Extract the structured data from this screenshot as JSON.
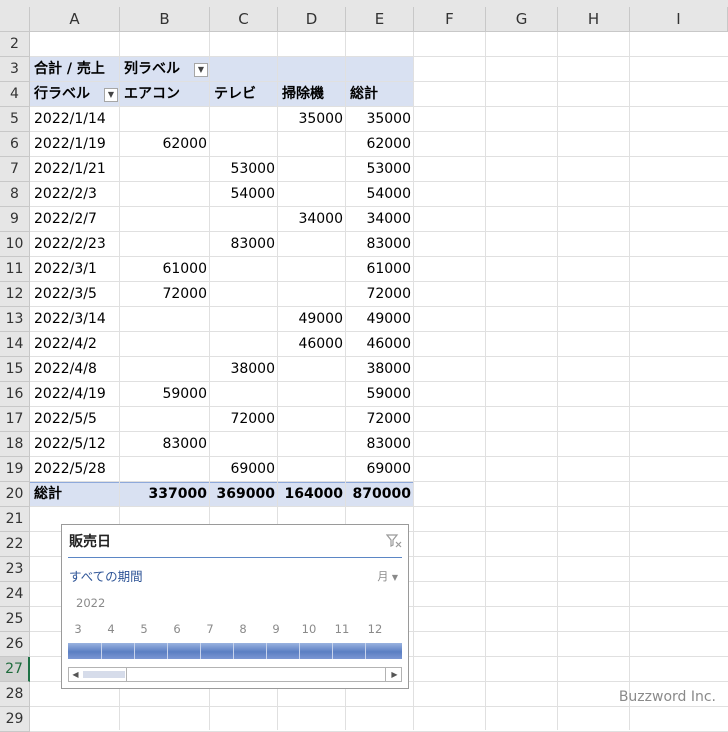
{
  "columns": [
    "A",
    "B",
    "C",
    "D",
    "E",
    "F",
    "G",
    "H",
    "I"
  ],
  "row_numbers": [
    "2",
    "3",
    "4",
    "5",
    "6",
    "7",
    "8",
    "9",
    "10",
    "11",
    "12",
    "13",
    "14",
    "15",
    "16",
    "17",
    "18",
    "19",
    "20",
    "21",
    "22",
    "23",
    "24",
    "25",
    "26",
    "27",
    "28",
    "29"
  ],
  "pivot": {
    "value_label": "合計 / 売上",
    "col_labels_label": "列ラベル",
    "row_labels_label": "行ラベル",
    "categories": [
      "エアコン",
      "テレビ",
      "掃除機",
      "総計"
    ],
    "rows": [
      {
        "date": "2022/1/14",
        "b": "",
        "c": "",
        "d": "35000",
        "e": "35000"
      },
      {
        "date": "2022/1/19",
        "b": "62000",
        "c": "",
        "d": "",
        "e": "62000"
      },
      {
        "date": "2022/1/21",
        "b": "",
        "c": "53000",
        "d": "",
        "e": "53000"
      },
      {
        "date": "2022/2/3",
        "b": "",
        "c": "54000",
        "d": "",
        "e": "54000"
      },
      {
        "date": "2022/2/7",
        "b": "",
        "c": "",
        "d": "34000",
        "e": "34000"
      },
      {
        "date": "2022/2/23",
        "b": "",
        "c": "83000",
        "d": "",
        "e": "83000"
      },
      {
        "date": "2022/3/1",
        "b": "61000",
        "c": "",
        "d": "",
        "e": "61000"
      },
      {
        "date": "2022/3/5",
        "b": "72000",
        "c": "",
        "d": "",
        "e": "72000"
      },
      {
        "date": "2022/3/14",
        "b": "",
        "c": "",
        "d": "49000",
        "e": "49000"
      },
      {
        "date": "2022/4/2",
        "b": "",
        "c": "",
        "d": "46000",
        "e": "46000"
      },
      {
        "date": "2022/4/8",
        "b": "",
        "c": "38000",
        "d": "",
        "e": "38000"
      },
      {
        "date": "2022/4/19",
        "b": "59000",
        "c": "",
        "d": "",
        "e": "59000"
      },
      {
        "date": "2022/5/5",
        "b": "",
        "c": "72000",
        "d": "",
        "e": "72000"
      },
      {
        "date": "2022/5/12",
        "b": "83000",
        "c": "",
        "d": "",
        "e": "83000"
      },
      {
        "date": "2022/5/28",
        "b": "",
        "c": "69000",
        "d": "",
        "e": "69000"
      }
    ],
    "total": {
      "label": "総計",
      "b": "337000",
      "c": "369000",
      "d": "164000",
      "e": "870000"
    }
  },
  "slicer": {
    "title": "販売日",
    "period_label": "すべての期間",
    "unit_label": "月",
    "year": "2022",
    "months": [
      "3",
      "4",
      "5",
      "6",
      "7",
      "8",
      "9",
      "10",
      "11",
      "12"
    ]
  },
  "watermark": "Buzzword Inc.",
  "colors": {
    "pivot_header": "#d9e1f2",
    "slicer_bar": "#5b7fc3",
    "accent": "#1e7145"
  }
}
